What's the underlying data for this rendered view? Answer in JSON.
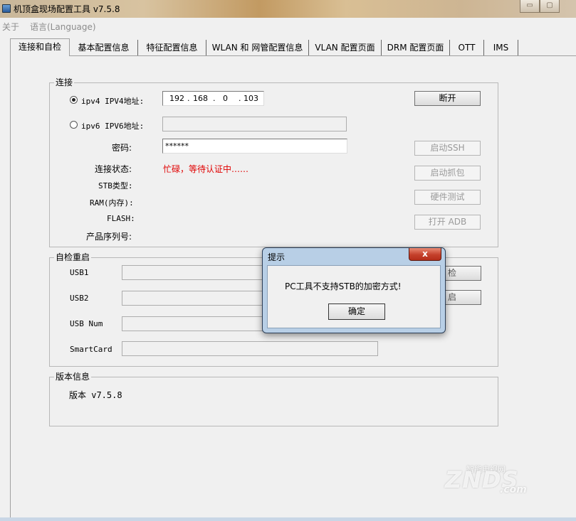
{
  "window": {
    "title": "机顶盒现场配置工具 v7.5.8",
    "minimize_glyph": "▭",
    "maximize_glyph": "▢"
  },
  "menu": [
    "关于",
    "语言(Language)"
  ],
  "tabs": [
    {
      "label": "连接和自检",
      "active": true
    },
    {
      "label": "基本配置信息"
    },
    {
      "label": "特征配置信息"
    },
    {
      "label": "WLAN 和 网管配置信息"
    },
    {
      "label": "VLAN 配置页面"
    },
    {
      "label": "DRM 配置页面"
    },
    {
      "label": "OTT"
    },
    {
      "label": "IMS"
    }
  ],
  "connection": {
    "group_title": "连接",
    "ipv4_label": "ipv4  IPV4地址:",
    "ipv4_checked": true,
    "ipv4_octets": [
      "192",
      "168",
      "0",
      "103"
    ],
    "ipv6_label": "ipv6  IPV6地址:",
    "password_label": "密码:",
    "password_value": "******",
    "status_label": "连接状态:",
    "status_value": "忙碌，等待认证中……",
    "status_color": "#e00000",
    "stb_type_label": "STB类型:",
    "ram_label": "RAM(内存):",
    "flash_label": "FLASH:",
    "serial_label": "产品序列号:",
    "disconnect_button": "断开",
    "ssh_button": "启动SSH",
    "capture_button": "启动抓包",
    "hwtest_button": "硬件测试",
    "adb_button": "打开 ADB"
  },
  "selftest": {
    "group_title": "自检重启",
    "usb1_label": "USB1",
    "usb2_label": "USB2",
    "usbnum_label": "USB Num",
    "smartcard_label": "SmartCard",
    "check_button_partial": "检",
    "restart_button_partial": "启"
  },
  "version": {
    "group_title": "版本信息",
    "text": "版本  v7.5.8"
  },
  "dialog": {
    "title": "提示",
    "message": "PC工具不支持STB的加密方式!",
    "ok_button": "确定",
    "close_glyph": "x"
  },
  "watermark": {
    "brand": "ZNDS",
    "suffix": ".com",
    "cn": "智能电视网"
  }
}
